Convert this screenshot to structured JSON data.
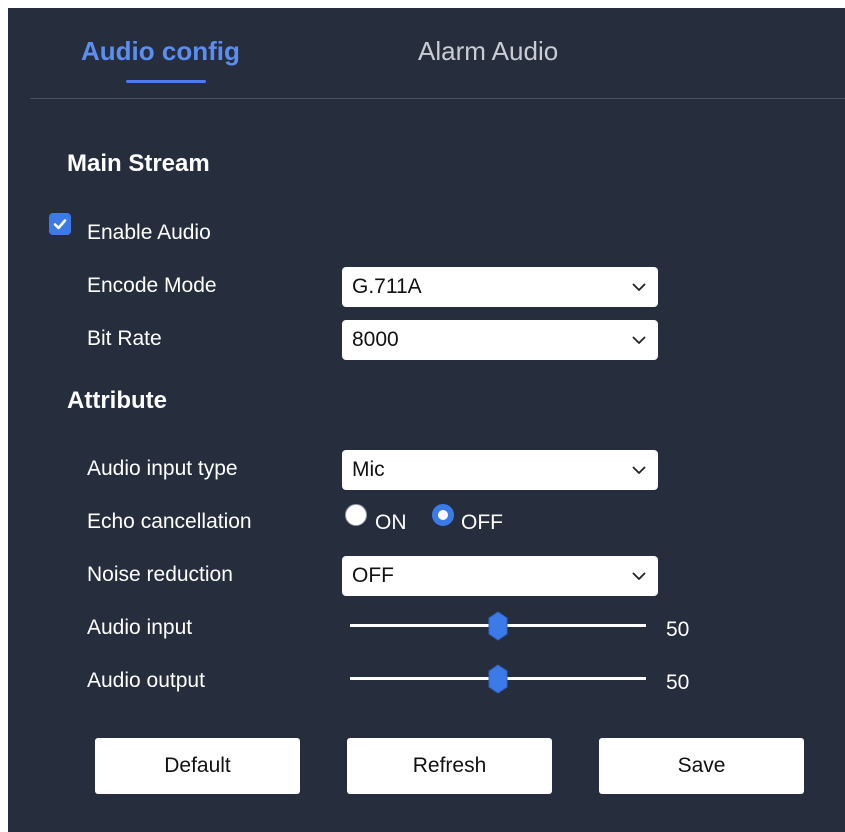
{
  "tabs": [
    {
      "label": "Audio config",
      "active": true
    },
    {
      "label": "Alarm Audio",
      "active": false
    }
  ],
  "main_stream": {
    "title": "Main Stream",
    "enable_audio": {
      "label": "Enable Audio",
      "checked": true
    },
    "encode_mode": {
      "label": "Encode Mode",
      "value": "G.711A"
    },
    "bit_rate": {
      "label": "Bit Rate",
      "value": "8000"
    }
  },
  "attribute": {
    "title": "Attribute",
    "audio_input_type": {
      "label": "Audio input type",
      "value": "Mic"
    },
    "echo_cancellation": {
      "label": "Echo cancellation",
      "on_label": "ON",
      "off_label": "OFF",
      "selected": "OFF"
    },
    "noise_reduction": {
      "label": "Noise reduction",
      "value": "OFF"
    },
    "audio_input": {
      "label": "Audio input",
      "value": "50",
      "max": 100
    },
    "audio_output": {
      "label": "Audio output",
      "value": "50",
      "max": 100
    }
  },
  "buttons": {
    "default_label": "Default",
    "refresh_label": "Refresh",
    "save_label": "Save"
  },
  "colors": {
    "panel_bg": "#262e3e",
    "accent": "#3c7ae8",
    "active_tab": "#5b8ef0"
  },
  "icons": {
    "checkbox": "checkmark-icon",
    "select": "chevron-down-icon",
    "slider": "slider-thumb-icon"
  }
}
